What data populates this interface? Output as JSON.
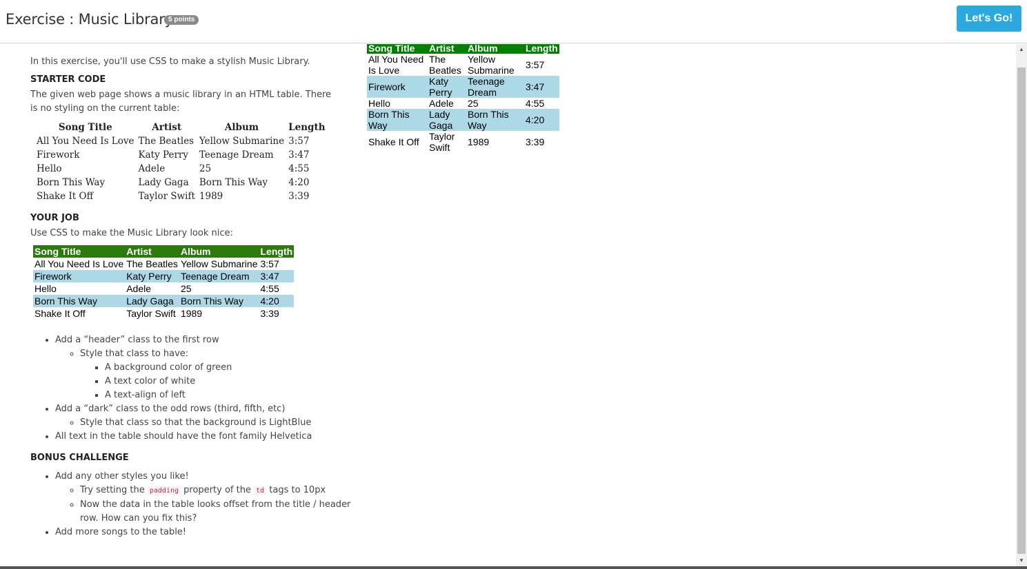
{
  "header": {
    "title": "Exercise : Music Library",
    "points": "5 points",
    "go_button": "Let's Go!"
  },
  "instructions": {
    "intro": "In this exercise, you'll use CSS to make a stylish Music Library.",
    "starter_heading": "STARTER CODE",
    "starter_text": "The given web page shows a music library in an HTML table. There is no styling on the current table:",
    "job_heading": "YOUR JOB",
    "job_text": "Use CSS to make the Music Library look nice:",
    "bonus_heading": "BONUS CHALLENGE",
    "steps": {
      "s1": "Add a “header” class to the first row",
      "s1a": "Style that class to have:",
      "s1a1": "A background color of green",
      "s1a2": "A text color of white",
      "s1a3": "A text-align of left",
      "s2": "Add a “dark” class to the odd rows (third, fifth, etc)",
      "s2a": "Style that class so that the background is LightBlue",
      "s3": "All text in the table should have the font family Helvetica"
    },
    "bonus": {
      "b1": "Add any other styles you like!",
      "b1a_pre": "Try setting the ",
      "b1a_code1": "padding",
      "b1a_mid": " property of the ",
      "b1a_code2": "td",
      "b1a_post": " tags to 10px",
      "b1b": "Now the data in the table looks offset from the title / header row. How can you fix this?",
      "b2": "Add more songs to the table!"
    }
  },
  "table": {
    "headers": {
      "title": "Song Title",
      "artist": "Artist",
      "album": "Album",
      "length": "Length"
    },
    "rows": [
      {
        "title": "All You Need Is Love",
        "artist": "The Beatles",
        "album": "Yellow Submarine",
        "length": "3:57"
      },
      {
        "title": "Firework",
        "artist": "Katy Perry",
        "album": "Teenage Dream",
        "length": "3:47"
      },
      {
        "title": "Hello",
        "artist": "Adele",
        "album": "25",
        "length": "4:55"
      },
      {
        "title": "Born This Way",
        "artist": "Lady Gaga",
        "album": "Born This Way",
        "length": "4:20"
      },
      {
        "title": "Shake It Off",
        "artist": "Taylor Swift",
        "album": "1989",
        "length": "3:39"
      }
    ]
  },
  "colors": {
    "accent_button": "#2da9e1",
    "header_green": "#008000",
    "row_lightblue": "#add8e6"
  },
  "icons": {
    "scroll_up": "▲",
    "scroll_down": "▼"
  }
}
